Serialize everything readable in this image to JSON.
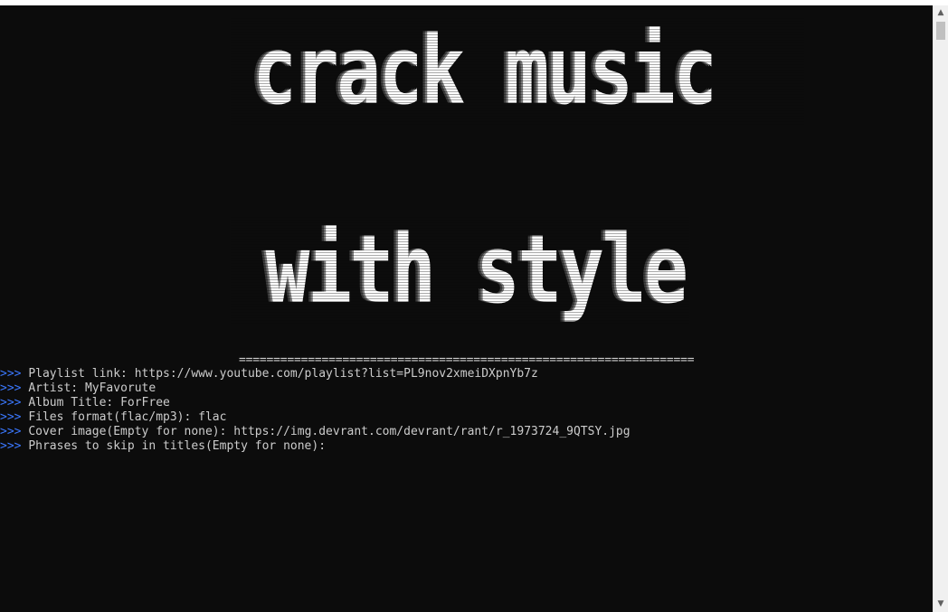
{
  "banner": {
    "line1": "crack music",
    "line2": "with style"
  },
  "separator": "==================================================================",
  "prompt_symbol": ">>>",
  "prompts": [
    {
      "label": "Playlist link:",
      "value": "https://www.youtube.com/playlist?list=PL9nov2xmeiDXpnYb7z"
    },
    {
      "label": "Artist:",
      "value": "MyFavorute"
    },
    {
      "label": "Album Title:",
      "value": "ForFree"
    },
    {
      "label": "Files format(flac/mp3):",
      "value": "flac"
    },
    {
      "label": "Cover image(Empty for none):",
      "value": "https://img.devrant.com/devrant/rant/r_1973724_9QTSY.jpg"
    },
    {
      "label": "Phrases to skip in titles(Empty for none):",
      "value": ""
    }
  ],
  "scrollbar": {
    "up_icon": "triangle-up-icon",
    "down_icon": "triangle-down-icon"
  },
  "colors": {
    "background": "#0c0c0c",
    "text": "#cccccc",
    "prompt_chevron": "#3b78ff"
  }
}
